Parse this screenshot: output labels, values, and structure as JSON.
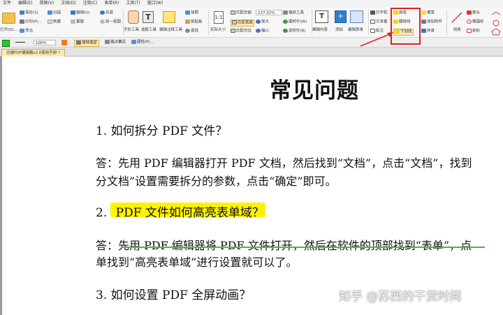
{
  "menu": [
    "文件",
    "编辑(E)",
    "视图(V)",
    "文档(D)",
    "注释(C)",
    "表单(R)",
    "工具(T)",
    "窗口(W)"
  ],
  "ribbon": {
    "open_label": "打开(O)...",
    "save_label": "保存(S)",
    "print_label": "打印(P)...",
    "export_label": "导出",
    "scan_label": "扫描",
    "new_label": "新建",
    "undo_label": "撤销(U)",
    "redo_label": "重做",
    "back_label": "后退",
    "forward_label": "前一视图",
    "hand_tool_label": "手形工具",
    "select_tool_label": "选取工具",
    "edit_annot_label": "编辑注释工具",
    "snapshot_label": "快照",
    "clipboard_label": "剪贴板",
    "find_label": "查找",
    "actual_size_label": "实际大小",
    "fit_page_label": "匹配页面",
    "fit_width_label": "匹配宽度",
    "fit_visible_label": "匹配可见",
    "zoom_value": "237.02%",
    "zoom_in_label": "放大",
    "zoom_out_label": "缩小",
    "zoom_tool_label": "缩放工具",
    "rotate_cw_label": "顺时针(W)",
    "rotate_ccw_label": "逆时针(R)",
    "edit_content_label": "编辑内容",
    "add_label": "添加",
    "edit_form_label": "编辑表单",
    "typewriter_label": "打字机",
    "textbox_label": "文本框",
    "callout_label": "标注",
    "highlight_label": "高亮",
    "strikeout_label": "删除线",
    "underline_label": "下划线",
    "note_label": "便签",
    "attach_label": "添加附件",
    "sound_label": "声音",
    "line_label": "线条",
    "arrow_label": "箭头",
    "ellipse_label": "椭圆形",
    "rect_label": "矩形"
  },
  "toolbar2": {
    "opacity": "100%",
    "keep_selected_label": "保持选定",
    "props_label": "属性(P)...",
    "anchor_label": "独点模式"
  },
  "tab": {
    "title": "迅捷PDF编辑器v2.0使用手册 *"
  },
  "document": {
    "title": "常见问题",
    "q1": "1.  如何拆分 PDF 文件？",
    "a1_line1": "答：先用 PDF 编辑器打开 PDF 文档，然后找到“文档”，点击“文档”，找到",
    "a1_line2": "分文档”设置需要拆分的参数，点击“确定”即可。",
    "q2_num": "2.",
    "q2_text": "PDF 文件如何高亮表单域？",
    "a2_line1": "答：先用 PDF 编辑器将 PDF 文件打开，然后在软件的顶部找到“表单”，点",
    "a2_line2": "单找到“高亮表单域”进行设置就可以了。",
    "q3": "3.  如何设置 PDF 全屏动画？"
  },
  "watermark": "知乎 @苏西的干货时间",
  "colors": {
    "highlight": "#fff200",
    "underline": "#3fbf3f",
    "callout_box": "#e02020",
    "tab_active": "#fde9b0"
  }
}
